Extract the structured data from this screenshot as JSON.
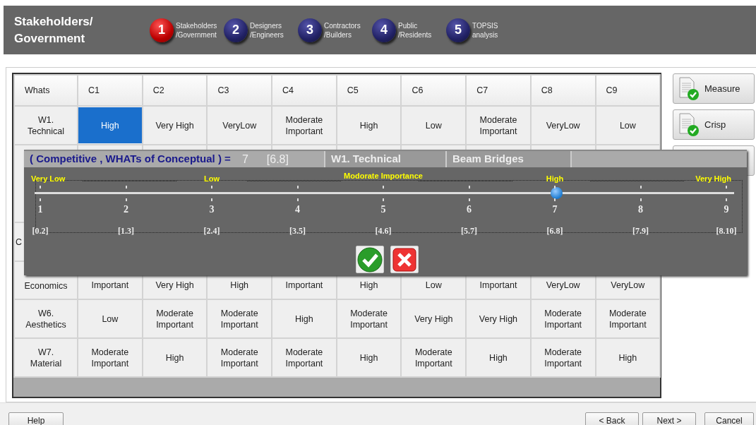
{
  "header": {
    "title": "Stakeholders/ Government"
  },
  "steps": [
    {
      "number": "1",
      "label": "Stakeholders /Government",
      "selected": true
    },
    {
      "number": "2",
      "label": "Designers /Engineers",
      "selected": false
    },
    {
      "number": "3",
      "label": "Contractors /Builders",
      "selected": false
    },
    {
      "number": "4",
      "label": "Public /Residents",
      "selected": false
    },
    {
      "number": "5",
      "label": "TOPSIS analysis",
      "selected": false
    }
  ],
  "table": {
    "columns": [
      "Whats",
      "C1",
      "C2",
      "C3",
      "C4",
      "C5",
      "C6",
      "C7",
      "C8",
      "C9"
    ],
    "rows": [
      {
        "label": "W1. Technical",
        "cells": [
          {
            "text": "High",
            "selected": true
          },
          {
            "text": "Very High",
            "selected": false
          },
          {
            "text": "VeryLow",
            "selected": false
          },
          {
            "text": "Moderate Important",
            "selected": false
          },
          {
            "text": "High",
            "selected": false
          },
          {
            "text": "Low",
            "selected": false
          },
          {
            "text": "Moderate Important",
            "selected": false
          },
          {
            "text": "VeryLow",
            "selected": false
          },
          {
            "text": "Low",
            "selected": false
          }
        ]
      },
      {
        "label": "C",
        "partly_hidden": true
      },
      {
        "label": "Economics",
        "partly_hidden": true,
        "cells": [
          {
            "text": "Important",
            "selected": false
          },
          {
            "text": "Very High",
            "selected": false
          },
          {
            "text": "High",
            "selected": false
          },
          {
            "text": "Important",
            "selected": false
          },
          {
            "text": "High",
            "selected": false
          },
          {
            "text": "Low",
            "selected": false
          },
          {
            "text": "Important",
            "selected": false
          },
          {
            "text": "VeryLow",
            "selected": false
          },
          {
            "text": "VeryLow",
            "selected": false
          }
        ]
      },
      {
        "label": "W6. Aesthetics",
        "cells": [
          {
            "text": "Low",
            "selected": false
          },
          {
            "text": "Moderate Important",
            "selected": false
          },
          {
            "text": "Moderate Important",
            "selected": false
          },
          {
            "text": "High",
            "selected": false
          },
          {
            "text": "Moderate Important",
            "selected": false
          },
          {
            "text": "Very High",
            "selected": false
          },
          {
            "text": "Very High",
            "selected": false
          },
          {
            "text": "Moderate Important",
            "selected": false
          },
          {
            "text": "Moderate Important",
            "selected": false
          }
        ]
      },
      {
        "label": "W7. Material",
        "cells": [
          {
            "text": "Moderate Important",
            "selected": false
          },
          {
            "text": "High",
            "selected": false
          },
          {
            "text": "Moderate Important",
            "selected": false
          },
          {
            "text": "Moderate Important",
            "selected": false
          },
          {
            "text": "High",
            "selected": false
          },
          {
            "text": "Moderate Important",
            "selected": false
          },
          {
            "text": "High",
            "selected": false
          },
          {
            "text": "Moderate Important",
            "selected": false
          },
          {
            "text": "High",
            "selected": false
          }
        ]
      }
    ]
  },
  "side_buttons": [
    {
      "label": "Measure"
    },
    {
      "label": "Crisp"
    }
  ],
  "dialog": {
    "title": "( Competitive , WHATs of Conceptual  ) =",
    "value": "7",
    "range": "[6.8]",
    "criterion": "W1. Technical",
    "alternative": "Beam Bridges",
    "slider": {
      "level": 0.75,
      "labels": [
        "Very Low",
        "Low",
        "Modorate Importance",
        "High",
        "Very High"
      ],
      "ticks": [
        "1",
        "2",
        "3",
        "4",
        "5",
        "6",
        "7",
        "8",
        "9"
      ],
      "ranges": [
        "[0.2]",
        "[1.3]",
        "[2.4]",
        "[3.5]",
        "[4.6]",
        "[5.7]",
        "[6.8]",
        "[7.9]",
        "[8.10]"
      ]
    }
  },
  "footer": {
    "buttons": [
      "Help",
      "< Back",
      "Next >",
      "Cancel"
    ]
  }
}
